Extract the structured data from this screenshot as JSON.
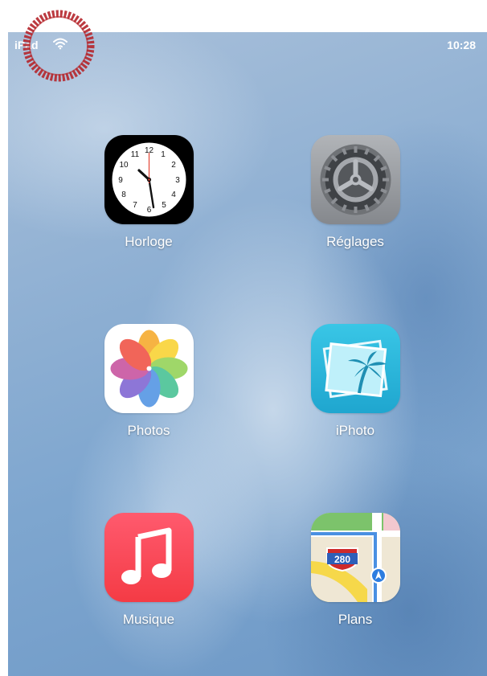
{
  "status_bar": {
    "carrier": "iPad",
    "wifi_icon": "wifi-icon",
    "time": "10:28"
  },
  "apps": [
    {
      "label": "Horloge",
      "icon": "clock-icon"
    },
    {
      "label": "Réglages",
      "icon": "gear-icon"
    },
    {
      "label": "Photos",
      "icon": "photos-flower-icon"
    },
    {
      "label": "iPhoto",
      "icon": "palm-tree-photo-icon"
    },
    {
      "label": "Musique",
      "icon": "music-note-icon"
    },
    {
      "label": "Plans",
      "icon": "map-icon",
      "badge_text": "280"
    }
  ],
  "colors": {
    "stamp": "#b5262c",
    "music_bg_top": "#ff5a6e",
    "music_bg_bottom": "#f43b45",
    "iphoto_bg": "#2bb7da",
    "gear_bg": "#9a9da2"
  }
}
